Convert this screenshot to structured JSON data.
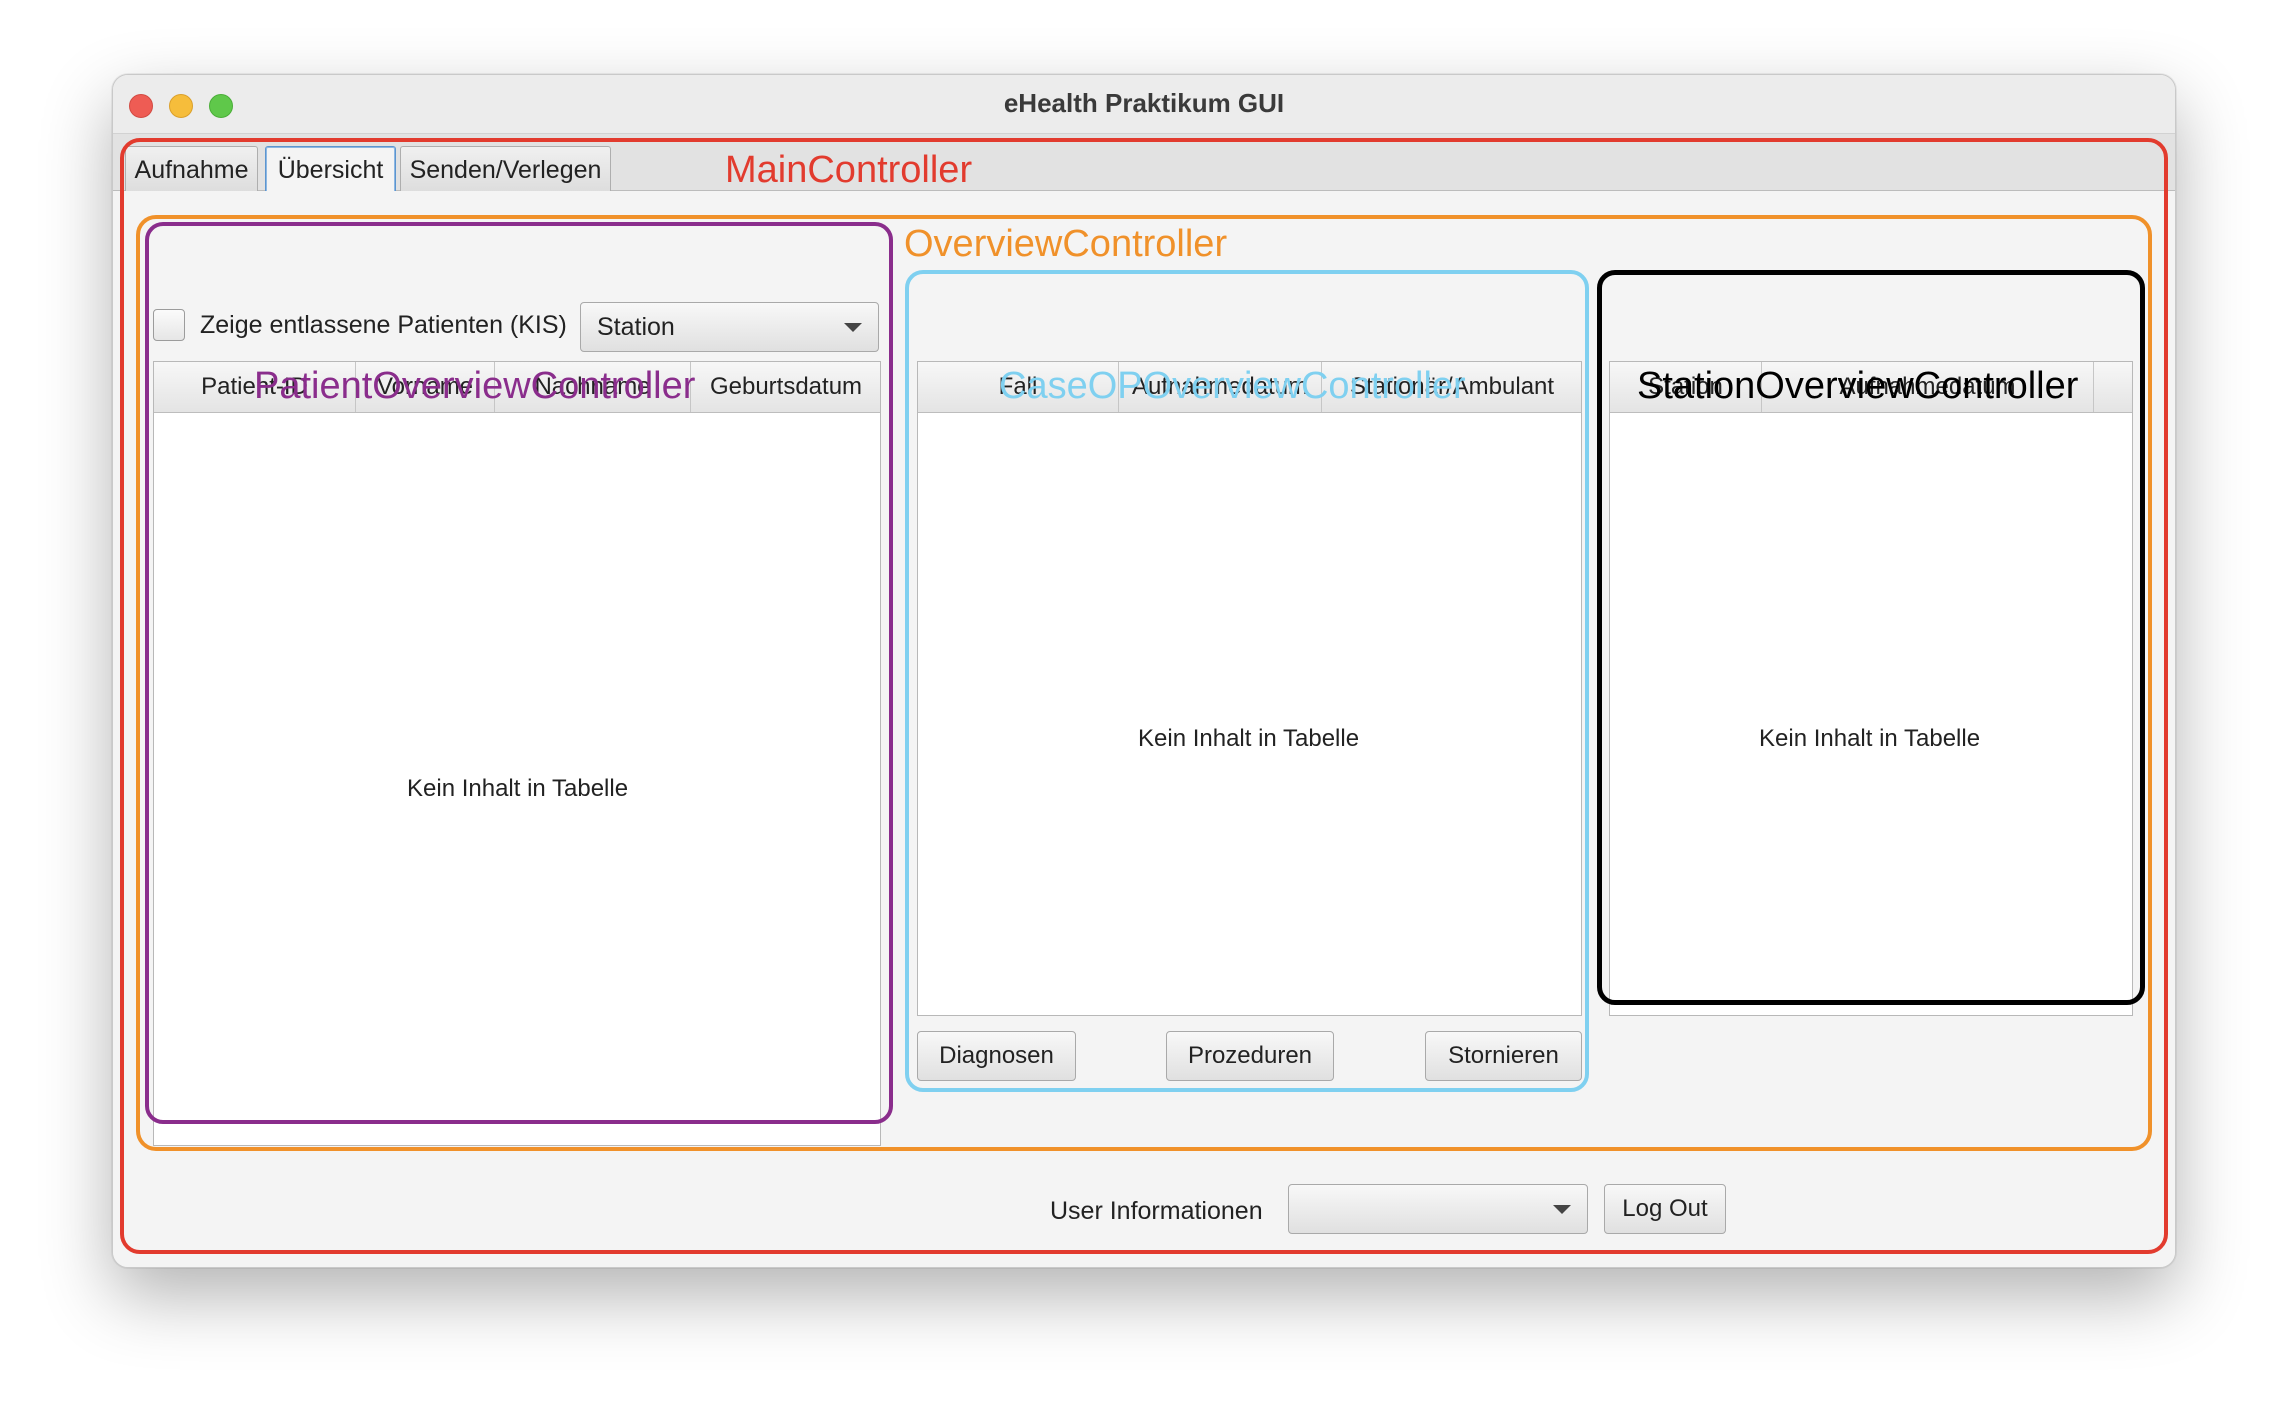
{
  "window": {
    "title": "eHealth Praktikum GUI"
  },
  "tabs": [
    {
      "label": "Aufnahme",
      "active": false
    },
    {
      "label": "Übersicht",
      "active": true
    },
    {
      "label": "Senden/Verlegen",
      "active": false
    }
  ],
  "annotations": {
    "main": {
      "label": "MainController",
      "color": "#e23b2e"
    },
    "overview": {
      "label": "OverviewController",
      "color": "#f0912a"
    },
    "patient": {
      "label": "PatientOverviewController",
      "color": "#8a2d8c"
    },
    "case": {
      "label": "CaseOPOverviewController",
      "color": "#7fd0f0"
    },
    "station": {
      "label": "StationOverviewController",
      "color": "#000000"
    }
  },
  "patient_panel": {
    "checkbox_label": "Zeige entlassene Patienten (KIS)",
    "checkbox_checked": false,
    "station_select": {
      "value": "Station"
    },
    "columns": [
      "Patient-ID",
      "Vorname",
      "Nachname",
      "Geburtsdatum"
    ],
    "empty_text": "Kein Inhalt in Tabelle"
  },
  "case_panel": {
    "columns": [
      "Fall",
      "Aufnahmedatum",
      "Stationär/Ambulant"
    ],
    "empty_text": "Kein Inhalt in Tabelle",
    "buttons": {
      "diagnosen": "Diagnosen",
      "prozeduren": "Prozeduren",
      "stornieren": "Stornieren"
    }
  },
  "station_panel": {
    "columns": [
      "Station",
      "Aufnahmedatum"
    ],
    "empty_text": "Kein Inhalt in Tabelle"
  },
  "footer": {
    "user_info_label": "User Informationen",
    "user_select": {
      "value": ""
    },
    "logout_label": "Log Out"
  }
}
